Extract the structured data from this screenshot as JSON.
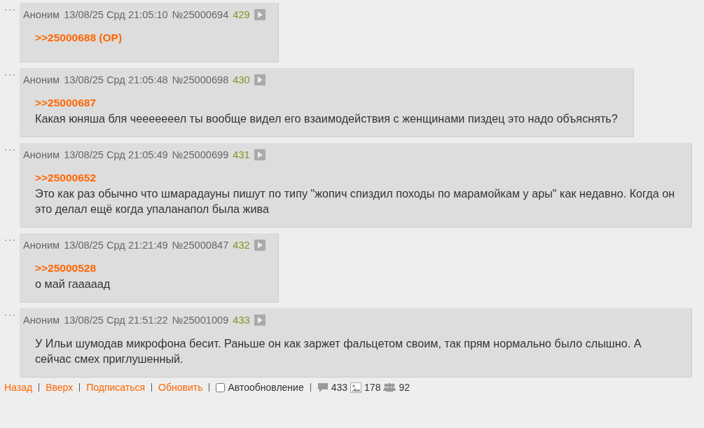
{
  "posts": [
    {
      "author": "Аноним",
      "date": "13/08/25 Срд 21:05:10",
      "number": "№25000694",
      "index": "429",
      "reply_link": ">>25000688 (OP)"
    },
    {
      "author": "Аноним",
      "date": "13/08/25 Срд 21:05:48",
      "number": "№25000698",
      "index": "430",
      "reply_link": ">>25000687",
      "text": "Какая юняша бля чееееееел ты вообще видел его взаимодействия с женщинами пиздец это надо объяснять?"
    },
    {
      "author": "Аноним",
      "date": "13/08/25 Срд 21:05:49",
      "number": "№25000699",
      "index": "431",
      "reply_link": ">>25000652",
      "text": "Это как раз обычно что шмарадауны пишут по типу \"жопич спиздил походы по марамойкам у ары\" как недавно. Когда он это делал ещё когда упаланапол была жива"
    },
    {
      "author": "Аноним",
      "date": "13/08/25 Срд 21:21:49",
      "number": "№25000847",
      "index": "432",
      "reply_link": ">>25000528",
      "text": "о май гааааад"
    },
    {
      "author": "Аноним",
      "date": "13/08/25 Срд 21:51:22",
      "number": "№25001009",
      "index": "433",
      "text": "У Ильи шумодав микрофона бесит. Раньше он как заржет фальцетом своим, так прям нормально было слышно. А сейчас смех приглушенный."
    }
  ],
  "footer": {
    "links": [
      "Назад",
      "Вверх",
      "Подписаться",
      "Обновить"
    ],
    "auto_update": {
      "label": "Автообновление",
      "checked": false
    },
    "posts_count": "433",
    "images_count": "178",
    "posters_count": "92"
  }
}
